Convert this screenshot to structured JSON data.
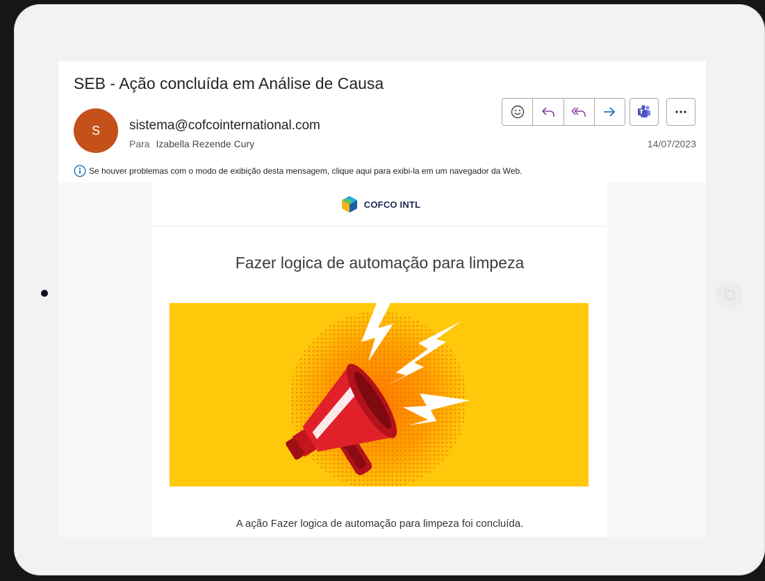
{
  "email": {
    "subject": "SEB - Ação concluída em Análise de Causa",
    "avatar_initial": "S",
    "sender": "sistema@cofcointernational.com",
    "to_label": "Para",
    "recipient": "Izabella Rezende Cury",
    "date": "14/07/2023",
    "info_message": "Se houver problemas com o modo de exibição desta mensagem, clique aqui para exibi-la em um navegador da Web."
  },
  "actions": {
    "icons": [
      "emoji-icon",
      "reply-icon",
      "reply-all-icon",
      "forward-icon",
      "teams-icon",
      "more-icon"
    ]
  },
  "body": {
    "logo_text": "COFCO INTL",
    "title": "Fazer logica de automação para limpeza",
    "message": "A ação Fazer logica de automação para limpeza foi concluída."
  },
  "colors": {
    "avatar": "#c4501a",
    "accent": "#0f6cbd",
    "banner": "#ffc80a",
    "megaphone": "#d7181f",
    "teams": "#5059c9"
  }
}
